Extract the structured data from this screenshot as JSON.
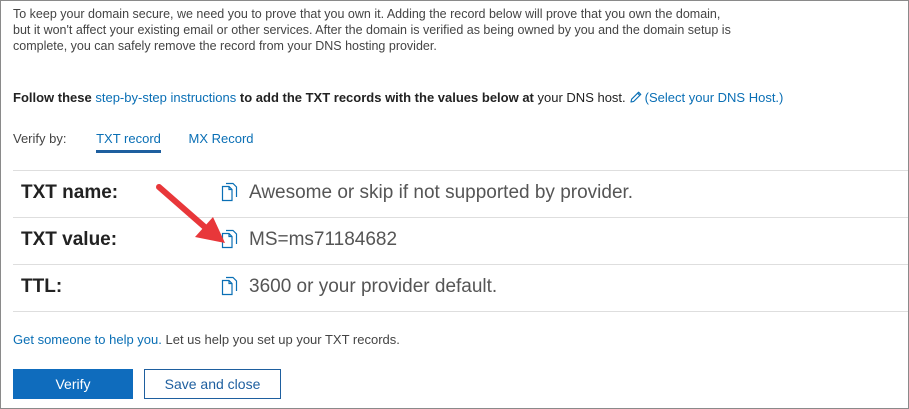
{
  "intro": {
    "text": "To keep your domain secure, we need you to prove that you own it. Adding the record below will prove that you own the domain, but it won't affect your existing email or other services. After the domain is verified as being owned by you and the domain setup is complete, you can safely remove the record from your DNS hosting provider."
  },
  "instructions": {
    "prefix": "Follow these",
    "link": "step-by-step instructions",
    "middle": "to add the TXT records with the values below at",
    "host": "your DNS host.",
    "select_host": "(Select your DNS Host.)"
  },
  "verify": {
    "label": "Verify by:",
    "tabs": [
      {
        "label": "TXT record",
        "active": true
      },
      {
        "label": "MX Record",
        "active": false
      }
    ]
  },
  "records": [
    {
      "label": "TXT name:",
      "value": "Awesome or skip if not supported by provider."
    },
    {
      "label": "TXT value:",
      "value": "MS=ms71184682"
    },
    {
      "label": "TTL:",
      "value": "3600 or your provider default."
    }
  ],
  "help": {
    "link": "Get someone to help you.",
    "text": "Let us help you set up your TXT records."
  },
  "buttons": {
    "verify": "Verify",
    "save_close": "Save and close"
  },
  "colors": {
    "link": "#0a6fb5",
    "primary_button": "#0f6cbd",
    "tab_underline": "#1e5f9f",
    "annotation_arrow": "#e8373a"
  },
  "icons": {
    "copy": "copy-icon",
    "edit": "pencil-icon"
  }
}
